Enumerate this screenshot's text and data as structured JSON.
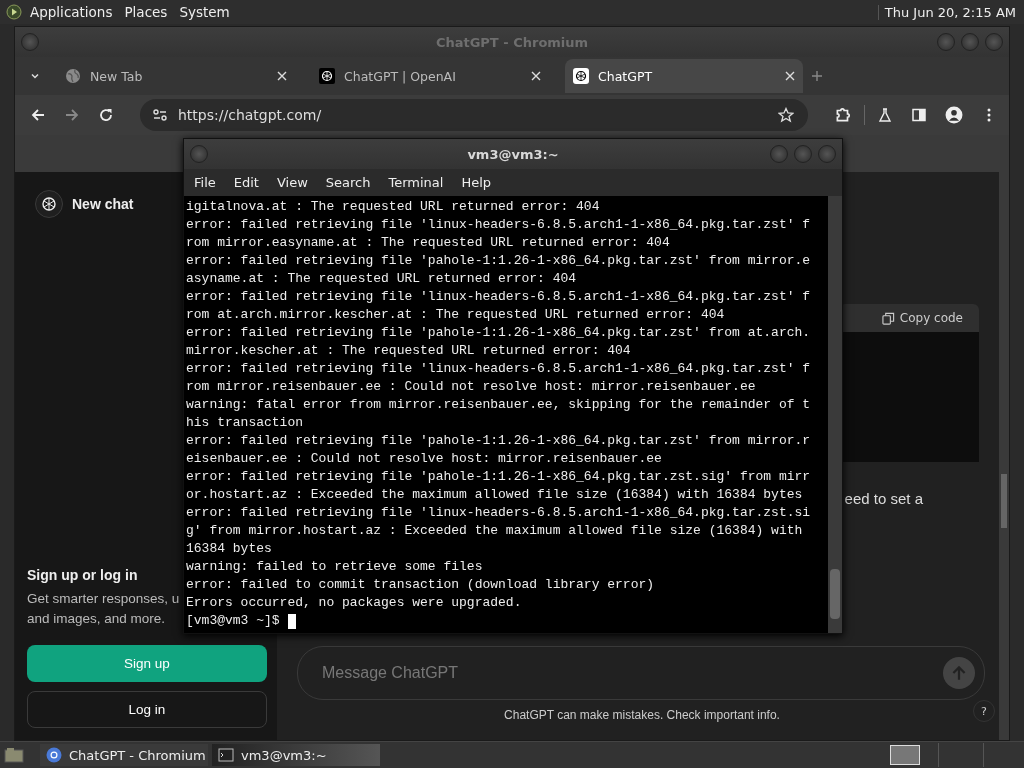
{
  "top_panel": {
    "menus": [
      "Applications",
      "Places",
      "System"
    ],
    "clock": "Thu Jun 20,  2:15 AM"
  },
  "browser": {
    "title": "ChatGPT - Chromium",
    "tabs": [
      {
        "label": "New Tab",
        "selected": false,
        "kind": "globe"
      },
      {
        "label": "ChatGPT | OpenAI",
        "selected": false,
        "kind": "openai-dark"
      },
      {
        "label": "ChatGPT",
        "selected": true,
        "kind": "openai-light"
      }
    ],
    "url": "https://chatgpt.com/"
  },
  "page": {
    "sidebar": {
      "new_chat": "New chat",
      "signup_title": "Sign up or log in",
      "signup_text": [
        "Get smarter responses, u",
        "and images, and more."
      ],
      "signup_button": "Sign up",
      "login_button": "Log in"
    },
    "code_block": {
      "copy_label": "Copy code"
    },
    "message_fragment": "eed to set a",
    "composer": {
      "placeholder": "Message ChatGPT"
    },
    "footer": "ChatGPT can make mistakes. Check important info.",
    "help": "?"
  },
  "terminal": {
    "title": "vm3@vm3:~",
    "menus": [
      "File",
      "Edit",
      "View",
      "Search",
      "Terminal",
      "Help"
    ],
    "lines": [
      "igitalnova.at : The requested URL returned error: 404",
      "error: failed retrieving file 'linux-headers-6.8.5.arch1-1-x86_64.pkg.tar.zst' f",
      "rom mirror.easyname.at : The requested URL returned error: 404",
      "error: failed retrieving file 'pahole-1:1.26-1-x86_64.pkg.tar.zst' from mirror.e",
      "asyname.at : The requested URL returned error: 404",
      "error: failed retrieving file 'linux-headers-6.8.5.arch1-1-x86_64.pkg.tar.zst' f",
      "rom at.arch.mirror.kescher.at : The requested URL returned error: 404",
      "error: failed retrieving file 'pahole-1:1.26-1-x86_64.pkg.tar.zst' from at.arch.",
      "mirror.kescher.at : The requested URL returned error: 404",
      "error: failed retrieving file 'linux-headers-6.8.5.arch1-1-x86_64.pkg.tar.zst' f",
      "rom mirror.reisenbauer.ee : Could not resolve host: mirror.reisenbauer.ee",
      "warning: fatal error from mirror.reisenbauer.ee, skipping for the remainder of t",
      "his transaction",
      "error: failed retrieving file 'pahole-1:1.26-1-x86_64.pkg.tar.zst' from mirror.r",
      "eisenbauer.ee : Could not resolve host: mirror.reisenbauer.ee",
      "error: failed retrieving file 'pahole-1:1.26-1-x86_64.pkg.tar.zst.sig' from mirr",
      "or.hostart.az : Exceeded the maximum allowed file size (16384) with 16384 bytes",
      "error: failed retrieving file 'linux-headers-6.8.5.arch1-1-x86_64.pkg.tar.zst.si",
      "g' from mirror.hostart.az : Exceeded the maximum allowed file size (16384) with",
      "16384 bytes",
      "warning: failed to retrieve some files",
      "error: failed to commit transaction (download library error)",
      "Errors occurred, no packages were upgraded."
    ],
    "prompt": "[vm3@vm3 ~]$"
  },
  "taskbar": {
    "tasks": [
      {
        "label": "ChatGPT - Chromium",
        "selected": false,
        "kind": "chromium"
      },
      {
        "label": "vm3@vm3:~",
        "selected": true,
        "kind": "terminal"
      }
    ]
  }
}
